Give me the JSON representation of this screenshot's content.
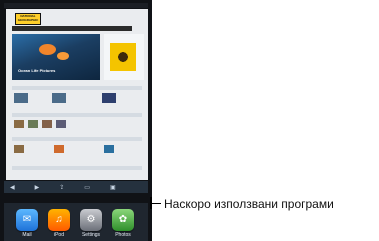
{
  "screen": {
    "page_brand": "NATIONAL GEOGRAPHIC",
    "hero_title": "Ocean Life Pictures",
    "toolbar_icons": [
      "back-icon",
      "forward-icon",
      "share-icon",
      "bookmarks-icon",
      "pages-icon"
    ],
    "dock_apps": [
      {
        "label": "Mail",
        "icon": "mail-icon"
      },
      {
        "label": "iPod",
        "icon": "music-icon"
      },
      {
        "label": "Settings",
        "icon": "settings-icon"
      },
      {
        "label": "Photos",
        "icon": "photos-icon"
      }
    ]
  },
  "callout": {
    "label": "Наскоро използвани програми"
  },
  "colors": {
    "accent_yellow": "#ffcf2a",
    "dock_bg": "#1f262f",
    "toolbar_bg": "#25313e"
  }
}
